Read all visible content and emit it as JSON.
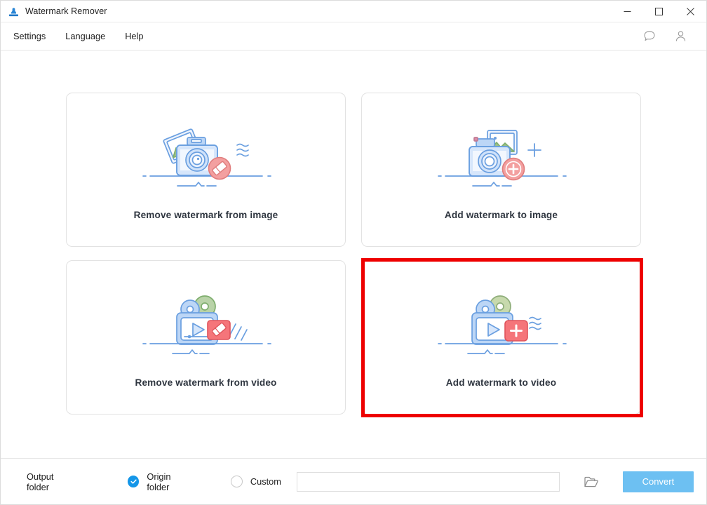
{
  "window": {
    "title": "Watermark Remover",
    "app_icon": "stamp-icon",
    "controls": {
      "minimize": "minimize-icon",
      "maximize": "maximize-icon",
      "close": "close-icon"
    }
  },
  "menubar": {
    "items": [
      {
        "label": "Settings"
      },
      {
        "label": "Language"
      },
      {
        "label": "Help"
      }
    ],
    "icons": [
      {
        "name": "feedback-icon"
      },
      {
        "name": "account-icon"
      }
    ]
  },
  "main": {
    "cards": [
      {
        "label": "Remove watermark from image",
        "art": "camera-eraser-art",
        "highlighted": false
      },
      {
        "label": "Add watermark to image",
        "art": "camera-plus-art",
        "highlighted": false
      },
      {
        "label": "Remove watermark from video",
        "art": "video-eraser-art",
        "highlighted": false
      },
      {
        "label": "Add watermark to video",
        "art": "video-plus-art",
        "highlighted": true
      }
    ],
    "annotation": {
      "shape": "rectangle",
      "color": "#ee0000",
      "target": "Add watermark to video"
    }
  },
  "bottombar": {
    "output_folder_label": "Output folder",
    "options": [
      {
        "label": "Origin folder",
        "selected": true
      },
      {
        "label": "Custom",
        "selected": false
      }
    ],
    "path_input": {
      "value": "",
      "placeholder": ""
    },
    "browse_icon": "folder-open-icon",
    "convert_label": "Convert",
    "convert_color": "#6dc0f2"
  },
  "colors": {
    "accent_blue": "#1496e8",
    "illustration_blue": "#6a9fe0",
    "illustration_fill": "#d6e6fb",
    "illustration_red": "#f08080",
    "illustration_green": "#9dc08b",
    "annotation_red": "#ee0000",
    "text_dark": "#2f3640"
  }
}
